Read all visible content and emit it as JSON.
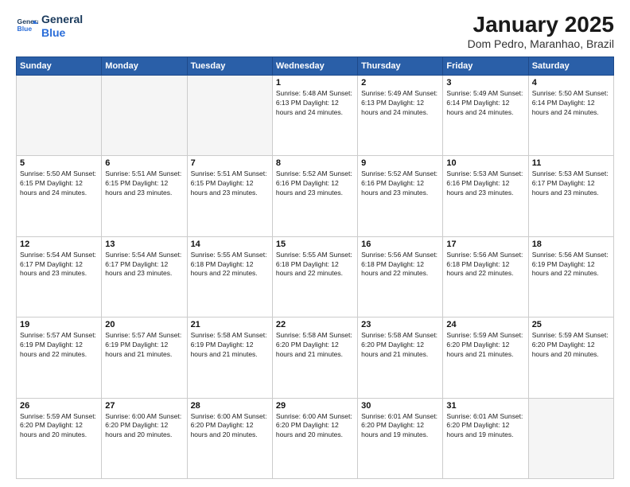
{
  "header": {
    "logo_line1": "General",
    "logo_line2": "Blue",
    "title": "January 2025",
    "subtitle": "Dom Pedro, Maranhao, Brazil"
  },
  "weekdays": [
    "Sunday",
    "Monday",
    "Tuesday",
    "Wednesday",
    "Thursday",
    "Friday",
    "Saturday"
  ],
  "weeks": [
    [
      {
        "day": "",
        "info": "",
        "empty": true
      },
      {
        "day": "",
        "info": "",
        "empty": true
      },
      {
        "day": "",
        "info": "",
        "empty": true
      },
      {
        "day": "1",
        "info": "Sunrise: 5:48 AM\nSunset: 6:13 PM\nDaylight: 12 hours\nand 24 minutes.",
        "empty": false
      },
      {
        "day": "2",
        "info": "Sunrise: 5:49 AM\nSunset: 6:13 PM\nDaylight: 12 hours\nand 24 minutes.",
        "empty": false
      },
      {
        "day": "3",
        "info": "Sunrise: 5:49 AM\nSunset: 6:14 PM\nDaylight: 12 hours\nand 24 minutes.",
        "empty": false
      },
      {
        "day": "4",
        "info": "Sunrise: 5:50 AM\nSunset: 6:14 PM\nDaylight: 12 hours\nand 24 minutes.",
        "empty": false
      }
    ],
    [
      {
        "day": "5",
        "info": "Sunrise: 5:50 AM\nSunset: 6:15 PM\nDaylight: 12 hours\nand 24 minutes.",
        "empty": false
      },
      {
        "day": "6",
        "info": "Sunrise: 5:51 AM\nSunset: 6:15 PM\nDaylight: 12 hours\nand 23 minutes.",
        "empty": false
      },
      {
        "day": "7",
        "info": "Sunrise: 5:51 AM\nSunset: 6:15 PM\nDaylight: 12 hours\nand 23 minutes.",
        "empty": false
      },
      {
        "day": "8",
        "info": "Sunrise: 5:52 AM\nSunset: 6:16 PM\nDaylight: 12 hours\nand 23 minutes.",
        "empty": false
      },
      {
        "day": "9",
        "info": "Sunrise: 5:52 AM\nSunset: 6:16 PM\nDaylight: 12 hours\nand 23 minutes.",
        "empty": false
      },
      {
        "day": "10",
        "info": "Sunrise: 5:53 AM\nSunset: 6:16 PM\nDaylight: 12 hours\nand 23 minutes.",
        "empty": false
      },
      {
        "day": "11",
        "info": "Sunrise: 5:53 AM\nSunset: 6:17 PM\nDaylight: 12 hours\nand 23 minutes.",
        "empty": false
      }
    ],
    [
      {
        "day": "12",
        "info": "Sunrise: 5:54 AM\nSunset: 6:17 PM\nDaylight: 12 hours\nand 23 minutes.",
        "empty": false
      },
      {
        "day": "13",
        "info": "Sunrise: 5:54 AM\nSunset: 6:17 PM\nDaylight: 12 hours\nand 23 minutes.",
        "empty": false
      },
      {
        "day": "14",
        "info": "Sunrise: 5:55 AM\nSunset: 6:18 PM\nDaylight: 12 hours\nand 22 minutes.",
        "empty": false
      },
      {
        "day": "15",
        "info": "Sunrise: 5:55 AM\nSunset: 6:18 PM\nDaylight: 12 hours\nand 22 minutes.",
        "empty": false
      },
      {
        "day": "16",
        "info": "Sunrise: 5:56 AM\nSunset: 6:18 PM\nDaylight: 12 hours\nand 22 minutes.",
        "empty": false
      },
      {
        "day": "17",
        "info": "Sunrise: 5:56 AM\nSunset: 6:18 PM\nDaylight: 12 hours\nand 22 minutes.",
        "empty": false
      },
      {
        "day": "18",
        "info": "Sunrise: 5:56 AM\nSunset: 6:19 PM\nDaylight: 12 hours\nand 22 minutes.",
        "empty": false
      }
    ],
    [
      {
        "day": "19",
        "info": "Sunrise: 5:57 AM\nSunset: 6:19 PM\nDaylight: 12 hours\nand 22 minutes.",
        "empty": false
      },
      {
        "day": "20",
        "info": "Sunrise: 5:57 AM\nSunset: 6:19 PM\nDaylight: 12 hours\nand 21 minutes.",
        "empty": false
      },
      {
        "day": "21",
        "info": "Sunrise: 5:58 AM\nSunset: 6:19 PM\nDaylight: 12 hours\nand 21 minutes.",
        "empty": false
      },
      {
        "day": "22",
        "info": "Sunrise: 5:58 AM\nSunset: 6:20 PM\nDaylight: 12 hours\nand 21 minutes.",
        "empty": false
      },
      {
        "day": "23",
        "info": "Sunrise: 5:58 AM\nSunset: 6:20 PM\nDaylight: 12 hours\nand 21 minutes.",
        "empty": false
      },
      {
        "day": "24",
        "info": "Sunrise: 5:59 AM\nSunset: 6:20 PM\nDaylight: 12 hours\nand 21 minutes.",
        "empty": false
      },
      {
        "day": "25",
        "info": "Sunrise: 5:59 AM\nSunset: 6:20 PM\nDaylight: 12 hours\nand 20 minutes.",
        "empty": false
      }
    ],
    [
      {
        "day": "26",
        "info": "Sunrise: 5:59 AM\nSunset: 6:20 PM\nDaylight: 12 hours\nand 20 minutes.",
        "empty": false
      },
      {
        "day": "27",
        "info": "Sunrise: 6:00 AM\nSunset: 6:20 PM\nDaylight: 12 hours\nand 20 minutes.",
        "empty": false
      },
      {
        "day": "28",
        "info": "Sunrise: 6:00 AM\nSunset: 6:20 PM\nDaylight: 12 hours\nand 20 minutes.",
        "empty": false
      },
      {
        "day": "29",
        "info": "Sunrise: 6:00 AM\nSunset: 6:20 PM\nDaylight: 12 hours\nand 20 minutes.",
        "empty": false
      },
      {
        "day": "30",
        "info": "Sunrise: 6:01 AM\nSunset: 6:20 PM\nDaylight: 12 hours\nand 19 minutes.",
        "empty": false
      },
      {
        "day": "31",
        "info": "Sunrise: 6:01 AM\nSunset: 6:20 PM\nDaylight: 12 hours\nand 19 minutes.",
        "empty": false
      },
      {
        "day": "",
        "info": "",
        "empty": true
      }
    ]
  ]
}
